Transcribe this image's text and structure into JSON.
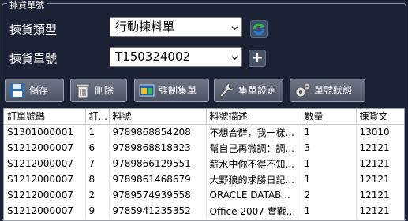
{
  "panel": {
    "title": "揀貨單號"
  },
  "form": {
    "type_label": "揀貨類型",
    "type_value": "行動揀料單",
    "number_label": "揀貨單號",
    "number_value": "T150324002",
    "add_label": "+"
  },
  "toolbar": {
    "save": "儲存",
    "delete": "刪除",
    "force_collect": "強制集單",
    "collect_settings": "集單設定",
    "number_status": "單號狀態"
  },
  "table": {
    "columns": [
      "訂單號碼",
      "訂...",
      "料號",
      "料號描述",
      "數量",
      "揀貨文"
    ],
    "rows": [
      [
        "S1301000001",
        "1",
        "9789868854208",
        "不想合群，我一樣...",
        "1",
        "13010"
      ],
      [
        "S1212000007",
        "6",
        "9789868818323",
        "幫自己再微調：調...",
        "3",
        "12121"
      ],
      [
        "S1212000007",
        "7",
        "9789866129551",
        "薪水中你不得不知...",
        "1",
        "12121"
      ],
      [
        "S1212000007",
        "8",
        "9789861468679",
        "大野狼的求勝日記...",
        "1",
        "12121"
      ],
      [
        "S1212000007",
        "2",
        "9789574939558",
        "ORACLE DATAB...",
        "2",
        "12121"
      ],
      [
        "S1212000007",
        "9",
        "9785941235352",
        "Office 2007 實戰...",
        "1",
        "12121"
      ]
    ]
  },
  "colors": {
    "background": "#1b2233",
    "text": "#ffffff"
  }
}
